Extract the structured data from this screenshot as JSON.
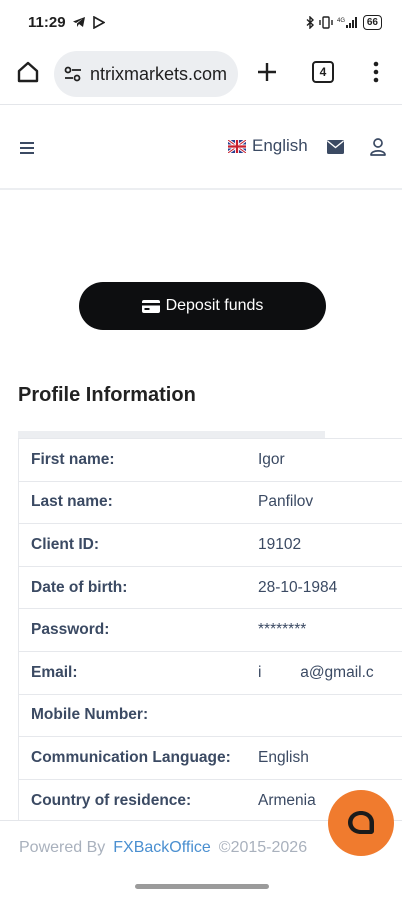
{
  "status": {
    "time": "11:29",
    "battery": "66"
  },
  "browser": {
    "url": "ntrixmarkets.com",
    "tab_count": "4"
  },
  "header": {
    "language": "English"
  },
  "deposit": {
    "label": "Deposit funds"
  },
  "profile": {
    "title": "Profile Information",
    "rows": [
      {
        "label": "First name:",
        "value": "Igor"
      },
      {
        "label": "Last name:",
        "value": "Panfilov"
      },
      {
        "label": "Client ID:",
        "value": "19102"
      },
      {
        "label": "Date of birth:",
        "value": "28-10-1984"
      },
      {
        "label": "Password:",
        "value": "********"
      },
      {
        "label": "Email:",
        "value": "i         a@gmail.c"
      },
      {
        "label": "Mobile Number:",
        "value": ""
      },
      {
        "label": "Communication Language:",
        "value": "English"
      },
      {
        "label": "Country of residence:",
        "value": "Armenia"
      }
    ]
  },
  "footer": {
    "powered_by": "Powered By",
    "brand": "FXBackOffice",
    "copyright": "©2015-2026"
  },
  "colors": {
    "accent": "#0d0e10",
    "label": "#3b4a63",
    "chat": "#f07b2e",
    "link": "#4a8fd0"
  }
}
